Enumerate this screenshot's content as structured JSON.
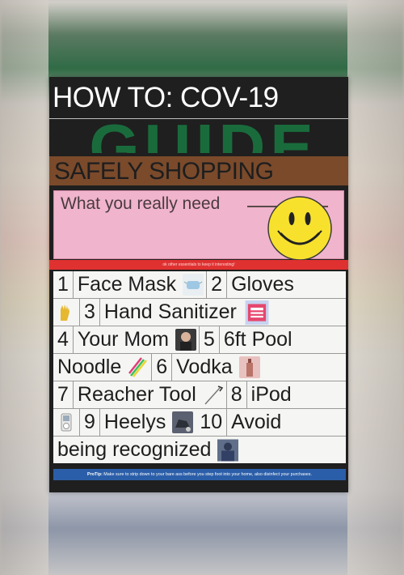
{
  "poster": {
    "title": "HOW TO: COV-19",
    "guide": "GUIDE",
    "subtitle": "SAFELY SHOPPING",
    "need_text": "What you really need",
    "red_note": "ok other essentials to keep it interesting!",
    "protip_label": "ProTip:",
    "protip_text": "Make sure to strip down to your bare ass before you step foot into your home, also disinfect your purchases."
  },
  "items": {
    "r1a": "1",
    "r1b": "Face Mask",
    "r1c": "2",
    "r1d": "Gloves",
    "r2a": "3",
    "r2b": "Hand Sanitizer",
    "r3a": "4",
    "r3b": "Your Mom",
    "r3c": "5",
    "r3d": "6ft Pool",
    "r4a": "Noodle",
    "r4b": "6",
    "r4c": "Vodka",
    "r5a": "7",
    "r5b": "Reacher Tool",
    "r5c": "8",
    "r5d": "iPod",
    "r6a": "9",
    "r6b": "Heelys",
    "r6c": "10",
    "r6d": "Avoid",
    "r7a": "being recognized"
  },
  "colors": {
    "guide_green": "#1a6b3c",
    "brown_band": "#7a4a2b",
    "pink_box": "#f0b4cc",
    "smiley_yellow": "#f7e12d",
    "red_band": "#e03131",
    "protip_blue": "#2b5ea8"
  },
  "icons": [
    "face-mask-thumb",
    "gloves-thumb",
    "hand-sanitizer-thumb",
    "your-mom-thumb",
    "pool-noodle-thumb",
    "vodka-thumb",
    "reacher-tool-thumb",
    "ipod-thumb",
    "heelys-thumb",
    "recognized-thumb",
    "smiley-icon"
  ]
}
